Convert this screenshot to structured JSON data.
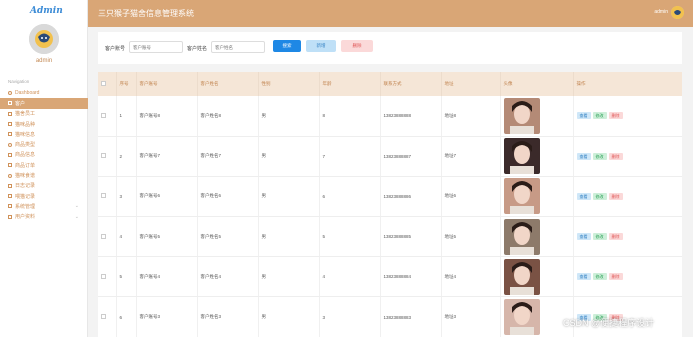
{
  "brand": "Admin",
  "header": {
    "title": "三只猴子猫舍信息管理系统",
    "user": "admin"
  },
  "sidebar": {
    "username": "admin",
    "caption": "Navigation",
    "items": [
      {
        "label": "Dashboard",
        "icon": "home-icon",
        "active": false,
        "has_children": false
      },
      {
        "label": "客户",
        "icon": "grid-icon",
        "active": true,
        "has_children": false
      },
      {
        "label": "猫舍员工",
        "icon": "grid-icon",
        "active": false,
        "has_children": false
      },
      {
        "label": "猫咪品种",
        "icon": "grid-icon",
        "active": false,
        "has_children": false
      },
      {
        "label": "猫咪信息",
        "icon": "grid-icon",
        "active": false,
        "has_children": false
      },
      {
        "label": "商品类型",
        "icon": "location-icon",
        "active": false,
        "has_children": false
      },
      {
        "label": "商品信息",
        "icon": "grid-icon",
        "active": false,
        "has_children": false
      },
      {
        "label": "商品订单",
        "icon": "grid-icon",
        "active": false,
        "has_children": false
      },
      {
        "label": "猫咪食谱",
        "icon": "location-icon",
        "active": false,
        "has_children": false
      },
      {
        "label": "日志记录",
        "icon": "grid-icon",
        "active": false,
        "has_children": false
      },
      {
        "label": "喂猫记录",
        "icon": "grid-icon",
        "active": false,
        "has_children": false
      },
      {
        "label": "系统管理",
        "icon": "grid-icon",
        "active": false,
        "has_children": true
      },
      {
        "label": "用户资料",
        "icon": "grid-icon",
        "active": false,
        "has_children": true
      }
    ]
  },
  "search": {
    "account_label": "客户账号",
    "account_placeholder": "客户账号",
    "name_label": "客户姓名",
    "name_placeholder": "客户姓名",
    "search_btn": "搜索",
    "add_btn": "新增",
    "delete_btn": "删除"
  },
  "table": {
    "columns": [
      "",
      "序号",
      "客户账号",
      "客户姓名",
      "性别",
      "年龄",
      "联系方式",
      "地址",
      "头像",
      "操作"
    ],
    "rows": [
      {
        "index": "1",
        "account": "客户账号8",
        "name": "客户姓名8",
        "gender": "男",
        "age": "8",
        "phone": "13823888888",
        "address": "地址8",
        "photo_bg": "#b48a76"
      },
      {
        "index": "2",
        "account": "客户账号7",
        "name": "客户姓名7",
        "gender": "男",
        "age": "7",
        "phone": "13823888887",
        "address": "地址7",
        "photo_bg": "#3b2a2a"
      },
      {
        "index": "3",
        "account": "客户账号6",
        "name": "客户姓名6",
        "gender": "男",
        "age": "6",
        "phone": "13823888886",
        "address": "地址6",
        "photo_bg": "#c79a86"
      },
      {
        "index": "4",
        "account": "客户账号5",
        "name": "客户姓名5",
        "gender": "男",
        "age": "5",
        "phone": "13823888885",
        "address": "地址5",
        "photo_bg": "#8d7a6a"
      },
      {
        "index": "5",
        "account": "客户账号4",
        "name": "客户姓名4",
        "gender": "男",
        "age": "4",
        "phone": "13823888884",
        "address": "地址4",
        "photo_bg": "#7a5244"
      },
      {
        "index": "6",
        "account": "客户账号3",
        "name": "客户姓名3",
        "gender": "男",
        "age": "3",
        "phone": "13823888883",
        "address": "地址3",
        "photo_bg": "#d6b6aa"
      }
    ],
    "ops": {
      "view": "查看",
      "edit": "修改",
      "delete": "删除"
    }
  },
  "watermark": "CSDN @便捷程序设计",
  "colors": {
    "accent": "#d9a676",
    "primary_button": "#1e88e5",
    "danger": "#e05656",
    "success": "#2fa35a"
  }
}
